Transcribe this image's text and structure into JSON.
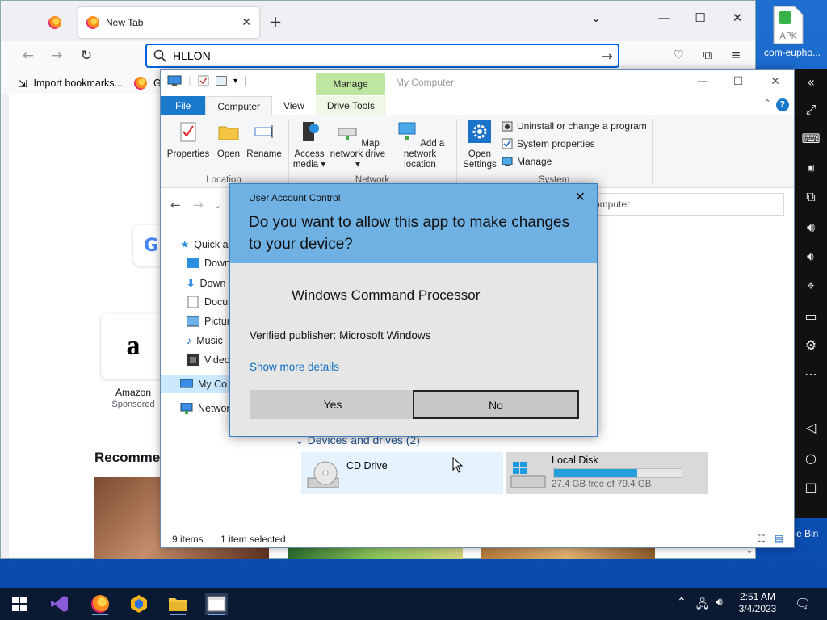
{
  "firefox": {
    "tab_title": "New Tab",
    "url_value": "HLLON",
    "bookmarks": [
      {
        "label": "Import bookmarks..."
      },
      {
        "label": "Get"
      }
    ],
    "shortcuts": {
      "google_letter": "G",
      "amazon_letter": "a",
      "amazon_label": "Amazon",
      "amazon_sub": "Sponsored"
    },
    "recommended": "Recommen"
  },
  "explorer": {
    "manage_tab": "Manage",
    "title": "My Computer",
    "tabs": {
      "file": "File",
      "computer": "Computer",
      "view": "View",
      "drive_tools": "Drive Tools"
    },
    "location": {
      "properties": "Properties",
      "open": "Open",
      "rename": "Rename",
      "group": "Location"
    },
    "network": {
      "access_media": "Access media",
      "map_drive": "Map network drive",
      "add_location": "Add a network location",
      "group": "Network"
    },
    "system": {
      "open_settings": "Open Settings",
      "uninstall": "Uninstall or change a program",
      "sys_props": "System properties",
      "manage": "Manage",
      "group": "System"
    },
    "address_fragment": "omputer",
    "sidebar": [
      {
        "label": "Quick a"
      },
      {
        "label": "Down"
      },
      {
        "label": "Down"
      },
      {
        "label": "Docu"
      },
      {
        "label": "Pictur"
      },
      {
        "label": "Music"
      },
      {
        "label": "Videos"
      },
      {
        "label": "My Co"
      },
      {
        "label": "Networ"
      }
    ],
    "folder_fragment_1": "s",
    "folder_fragment_2": "s",
    "devices_header": "Devices and drives (2)",
    "drives": [
      {
        "name": "CD Drive"
      },
      {
        "name": "Local Disk",
        "free": "27.4 GB free of 79.4 GB",
        "used_fraction": 0.655
      }
    ],
    "status": {
      "items": "9 items",
      "selected": "1 item selected"
    }
  },
  "uac": {
    "caption": "User Account Control",
    "question": "Do you want to allow this app to make changes to your device?",
    "app_name": "Windows Command Processor",
    "publisher": "Verified publisher: Microsoft Windows",
    "more_details": "Show more details",
    "yes": "Yes",
    "no": "No"
  },
  "desktop": {
    "apk_label": "com-eupho...",
    "apk_text": "APK",
    "recycle_fragment": "e Bin"
  },
  "taskbar": {
    "time": "2:51 AM",
    "date": "3/4/2023"
  }
}
